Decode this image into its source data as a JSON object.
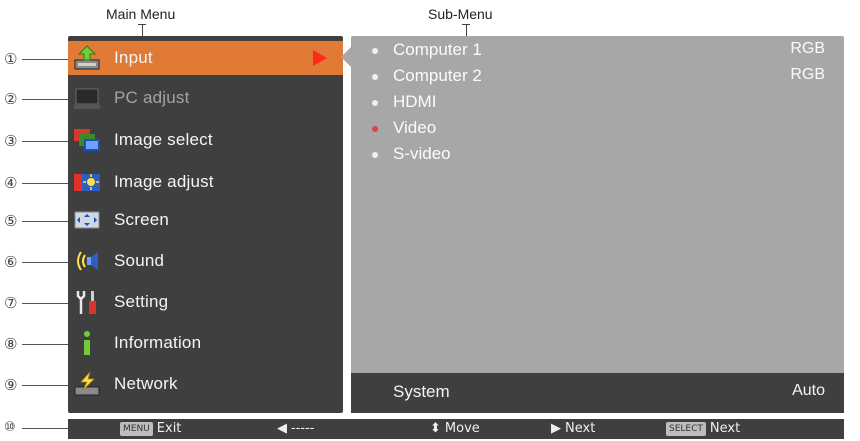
{
  "callouts": {
    "main_menu": "Main Menu",
    "sub_menu": "Sub-Menu"
  },
  "markers": [
    "①",
    "②",
    "③",
    "④",
    "⑤",
    "⑥",
    "⑦",
    "⑧",
    "⑨",
    "⑩"
  ],
  "main_menu": {
    "items": [
      {
        "label": "Input",
        "icon": "input-icon",
        "state": "active"
      },
      {
        "label": "PC adjust",
        "icon": "pc-adjust-icon",
        "state": "disabled"
      },
      {
        "label": "Image select",
        "icon": "image-select-icon",
        "state": "normal"
      },
      {
        "label": "Image adjust",
        "icon": "image-adjust-icon",
        "state": "normal"
      },
      {
        "label": "Screen",
        "icon": "screen-icon",
        "state": "normal"
      },
      {
        "label": "Sound",
        "icon": "sound-icon",
        "state": "normal"
      },
      {
        "label": "Setting",
        "icon": "setting-icon",
        "state": "normal"
      },
      {
        "label": "Information",
        "icon": "information-icon",
        "state": "normal"
      },
      {
        "label": "Network",
        "icon": "network-icon",
        "state": "normal"
      }
    ]
  },
  "sub_menu": {
    "items": [
      {
        "label": "Computer 1",
        "value": "RGB",
        "selected": false
      },
      {
        "label": "Computer 2",
        "value": "RGB",
        "selected": false
      },
      {
        "label": "HDMI",
        "value": "",
        "selected": false
      },
      {
        "label": "Video",
        "value": "",
        "selected": true
      },
      {
        "label": "S-video",
        "value": "",
        "selected": false
      }
    ],
    "bottom": {
      "label": "System",
      "value": "Auto"
    }
  },
  "bottom_bar": {
    "exit_key": "MENU",
    "exit_label": "Exit",
    "back_label": "-----",
    "move_label": "Move",
    "next_label": "Next",
    "select_key": "SELECT",
    "select_next_label": "Next"
  },
  "colors": {
    "panel_dark": "#3f3f3f",
    "panel_light": "#a7a7a7",
    "active": "#e07a35",
    "arrow": "#ff2a1a",
    "selected_bullet": "#e0423e"
  }
}
